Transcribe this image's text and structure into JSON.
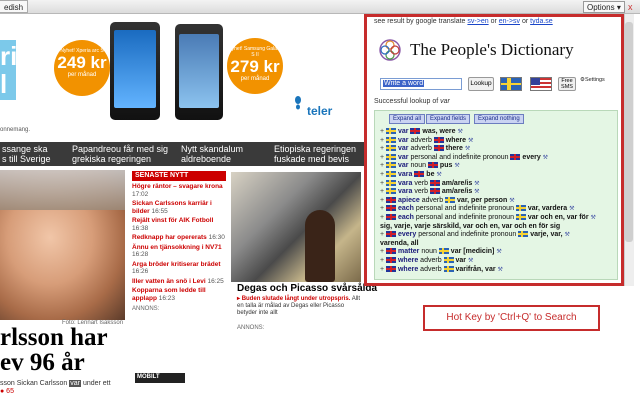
{
  "browser": {
    "lang_button": "edish",
    "options_label": "Options",
    "close_label": "x"
  },
  "ad": {
    "logo_letters": [
      "ri",
      "l"
    ],
    "note": "onnemang.",
    "phone1": {
      "offer": "Nyhet! Xperia arc S",
      "price": "249 kr",
      "unit": "per månad"
    },
    "phone2": {
      "offer": "Nyhet! Samsung Galaxy S II",
      "price": "279 kr",
      "unit": "per månad"
    },
    "brand": "teler"
  },
  "headlines": [
    "ssange ska\ns till Sverige",
    "Papandreou får med sig\ngrekiska regeringen",
    "Nytt skandalum\naldreboende",
    "Etiopiska regeringen\nfuskade med bevis"
  ],
  "article": {
    "photo_credit": "Foto: Lennart Isaksson",
    "name_line1": "rlsson har",
    "name_line2": "ev 96 år",
    "lede_before": "sson Sickan Carlsson ",
    "lede_hl": "var",
    "lede_after": " under ett",
    "lede_meta": "● 65"
  },
  "news": {
    "header": "SENASTE NYTT",
    "items": [
      {
        "text": "Högre räntor – svagare krona",
        "time": "17:02"
      },
      {
        "text": "Sickan Carlssons karriär i bilder",
        "time": "16:55"
      },
      {
        "text": "Rejält vinst för AIK Fotboll",
        "time": "16:38"
      },
      {
        "text": "Redknapp har opererats",
        "time": "16:30"
      },
      {
        "text": "Ännu en tjänsokkning i NV71",
        "time": "16:28"
      },
      {
        "text": "Arga bröder kritiserar brädet",
        "time": "16:26"
      },
      {
        "text": "Iller vatten än snö i Levi",
        "time": "16:25"
      },
      {
        "text": "Kopparna som ledde till applapp",
        "time": "16:23"
      }
    ],
    "annons": "ANNONS:",
    "mobilt": "MOBILT"
  },
  "painting": {
    "caption": "Degas och Picasso svårsålda",
    "sub_red": "Buden slutade långt under utropspris.",
    "sub_rest": " Allt en talla är målad av Degas eller Picasso betyder inte allt",
    "annons": "ANNONS:"
  },
  "dictionary": {
    "top_text": "see result by google translate",
    "link1": "sv->en",
    "or1": "or",
    "link2": "en->sv",
    "or2": "or",
    "link3": "tyda.se",
    "title": "The People's Dictionary",
    "input_value": "Write a word",
    "lookup_label": "Lookup",
    "free_label": "Free\nSMS",
    "settings_label": "Settings",
    "success_prefix": "Successful lookup of",
    "success_word": "var",
    "expand_all": "Expand all",
    "expand_fields": "Expand fields",
    "expand_nothing": "Expand nothing",
    "rows": [
      {
        "a": "var",
        "flag_a": "se",
        "b": "was, were",
        "flag_b": "uk"
      },
      {
        "a": "var",
        "pos": "adverb",
        "flag_a": "se",
        "b": "where",
        "flag_b": "uk"
      },
      {
        "a": "var",
        "pos": "adverb",
        "flag_a": "se",
        "b": "there",
        "flag_b": "uk"
      },
      {
        "a": "var",
        "pos": "personal and indefinite pronoun",
        "flag_a": "se",
        "b": "every",
        "flag_b": "uk"
      },
      {
        "a": "var",
        "pos": "noun",
        "flag_a": "se",
        "b": "pus",
        "flag_b": "uk"
      },
      {
        "a": "vara",
        "flag_a": "se",
        "b": "be",
        "flag_b": "uk"
      },
      {
        "a": "vara",
        "pos": "verb",
        "flag_a": "se",
        "b": "am/are/is",
        "flag_b": "uk"
      },
      {
        "a": "vara",
        "pos": "verb",
        "flag_a": "se",
        "b": "am/are/is",
        "flag_b": "uk"
      },
      {
        "a": "apiece",
        "pos": "adverb",
        "flag_a": "uk",
        "b": "var, per person",
        "flag_b": "se"
      },
      {
        "a": "each",
        "pos": "personal and indefinite pronoun",
        "flag_a": "uk",
        "b": "var, vardera",
        "flag_b": "se"
      },
      {
        "a": "each",
        "pos": "personal and indefinite pronoun",
        "flag_a": "uk",
        "b": "var och en, var för",
        "flag_b": "se"
      },
      {
        "a": "sig, varje, varje särskild, var och en, var och en för sig",
        "plain": true
      },
      {
        "a": "every",
        "pos": "personal and indefinite pronoun",
        "flag_a": "uk",
        "b": "varje, var,",
        "flag_b": "se"
      },
      {
        "a": "varenda, all",
        "plain": true
      },
      {
        "a": "matter",
        "pos": "noun",
        "flag_a": "uk",
        "b": "var [medicin]",
        "flag_b": "se"
      },
      {
        "a": "where",
        "pos": "adverb",
        "flag_a": "uk",
        "b": "var",
        "flag_b": "se"
      },
      {
        "a": "where",
        "pos": "adverb",
        "flag_a": "uk",
        "b": "varifrån, var",
        "flag_b": "se"
      }
    ]
  },
  "hotkey": "Hot Key by 'Ctrl+Q' to Search"
}
